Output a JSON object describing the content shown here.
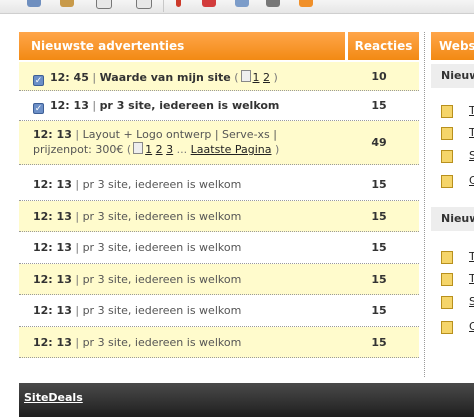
{
  "colors": {
    "header_orange": "#f28a13",
    "row_highlight": "#fffbcc",
    "footer_dark": "#2a2a2a"
  },
  "main": {
    "title": "Nieuwste advertenties",
    "reacties_label": "Reacties",
    "rows": [
      {
        "time": "12: 45",
        "title": "Waarde van mijn site",
        "pages": [
          "1",
          "2"
        ],
        "count": "10"
      },
      {
        "time": "12: 13",
        "title": "pr 3 site, iedereen is welkom",
        "count": "15"
      },
      {
        "time": "12: 13",
        "title": "Layout + Logo ontwerp | Serve-xs | prijzenpot: 300€",
        "pages": [
          "1",
          "2",
          "3"
        ],
        "last_page": "Laatste Pagina",
        "ellipsis": "...",
        "count": "49"
      },
      {
        "time": "12: 13",
        "title": "pr 3 site, iedereen is welkom",
        "count": "15"
      },
      {
        "time": "12: 13",
        "title": "pr 3 site, iedereen is welkom",
        "count": "15"
      },
      {
        "time": "12: 13",
        "title": "pr 3 site, iedereen is welkom",
        "count": "15"
      },
      {
        "time": "12: 13",
        "title": "pr 3 site, iedereen is welkom",
        "count": "15"
      },
      {
        "time": "12: 13",
        "title": "pr 3 site, iedereen is welkom",
        "count": "15"
      },
      {
        "time": "12: 13",
        "title": "pr 3 site, iedereen is welkom",
        "count": "15"
      }
    ]
  },
  "sidebar": {
    "title": "Websi",
    "sections": [
      {
        "label": "Nieuw",
        "items": [
          "T",
          "T",
          "S",
          "C"
        ]
      },
      {
        "label": "Nieuw",
        "items": [
          "T",
          "T",
          "S",
          "C"
        ]
      }
    ]
  },
  "footer": {
    "label": "SiteDeals"
  },
  "toolbar": {
    "separator": "|",
    "open_paren": "(",
    "close_paren": ")"
  }
}
